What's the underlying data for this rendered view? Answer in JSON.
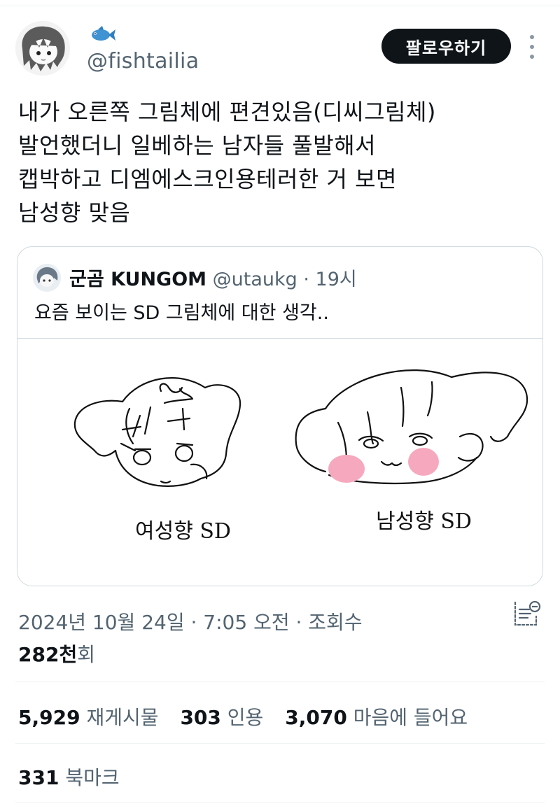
{
  "author": {
    "handle": "@fishtailia",
    "avatar_icon": "sketch-avatar",
    "name_icon": "fish-emoji-icon"
  },
  "follow_button": {
    "label": "팔로우하기"
  },
  "more_icon": "more-vertical-icon",
  "tweet": {
    "text": "내가 오른쪽 그림체에 편견있음(디씨그림체)\n발언했더니 일베하는 남자들 풀발해서\n캡박하고 디엠에스크인용테러한 거 보면\n남성향 맞음"
  },
  "quote": {
    "name": "군곰 KUNGOM",
    "handle": "@utaukg",
    "time": "· 19시",
    "text": "요즘 보이는 SD 그림체에 대한 생각..",
    "image": {
      "left_caption": "여성향 SD",
      "right_caption": "남성향 SD",
      "blush_color": "#f6a9be"
    }
  },
  "meta": {
    "timestamp": "2024년 10월 24일 · 7:05 오전 · 조회수",
    "views_number": "282천",
    "views_label": "회"
  },
  "stats": {
    "retweets_number": "5,929",
    "retweets_label": "재게시물",
    "quotes_number": "303",
    "quotes_label": "인용",
    "likes_number": "3,070",
    "likes_label": "마음에 들어요"
  },
  "bookmarks": {
    "number": "331",
    "label": "북마크"
  },
  "colors": {
    "text_primary": "#0f1419",
    "text_secondary": "#536471",
    "border": "#cfd9de",
    "button_bg": "#0f1419"
  }
}
